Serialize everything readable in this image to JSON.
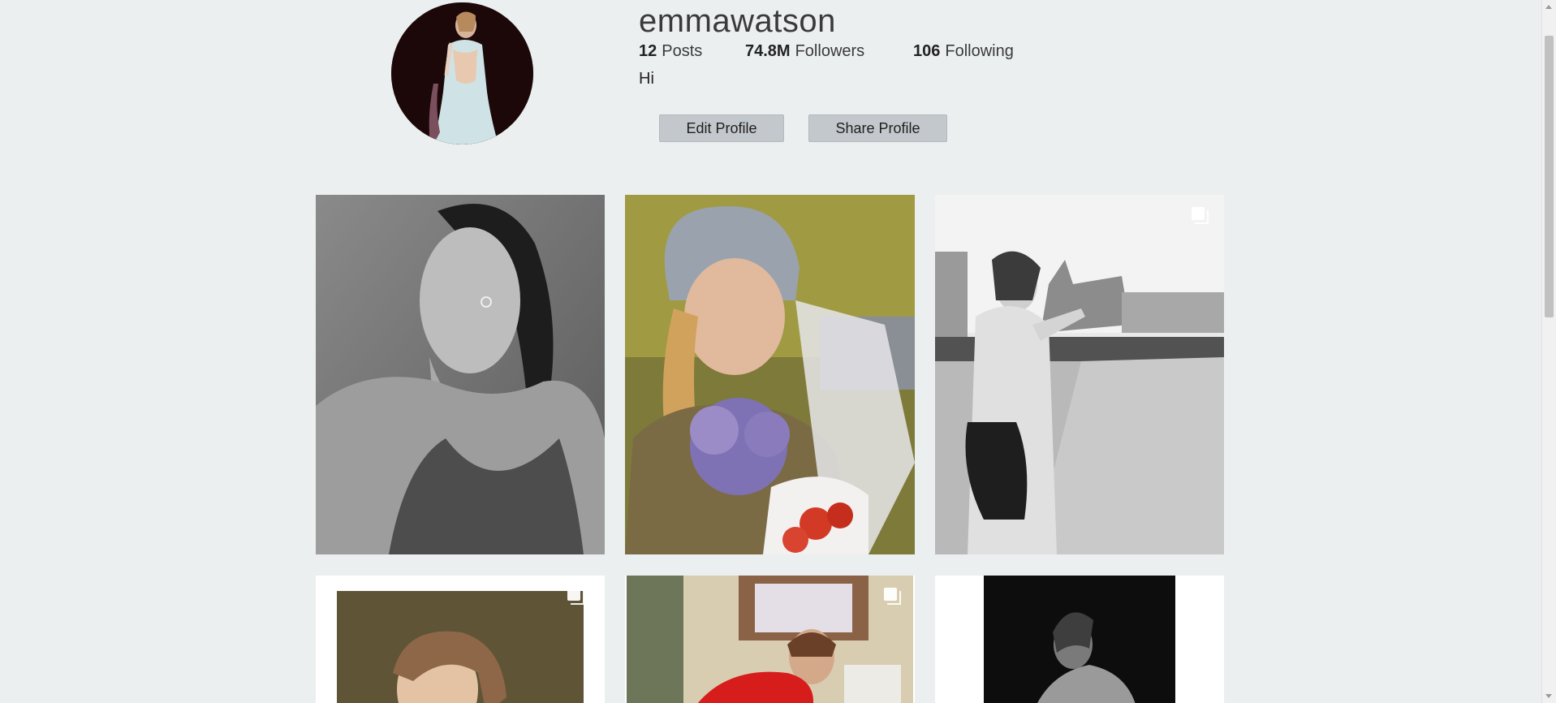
{
  "profile": {
    "username": "emmawatson",
    "stats": {
      "posts_count": "12",
      "posts_label": "Posts",
      "followers_count": "74.8M",
      "followers_label": "Followers",
      "following_count": "106",
      "following_label": "Following"
    },
    "bio": "Hi"
  },
  "actions": {
    "edit_label": "Edit Profile",
    "share_label": "Share Profile"
  },
  "posts": [
    {
      "kind": "bw-portrait",
      "multi": false
    },
    {
      "kind": "beanie-flowers",
      "multi": false
    },
    {
      "kind": "bw-street",
      "multi": true
    },
    {
      "kind": "portrait-framed",
      "multi": true
    },
    {
      "kind": "red-sweater",
      "multi": true
    },
    {
      "kind": "bw-back",
      "multi": false
    }
  ],
  "icons": {
    "multi_post": "copy-icon"
  },
  "colors": {
    "background": "#eceff0",
    "button": "#c3c8cd",
    "scroll_thumb": "#c1c1c1"
  }
}
